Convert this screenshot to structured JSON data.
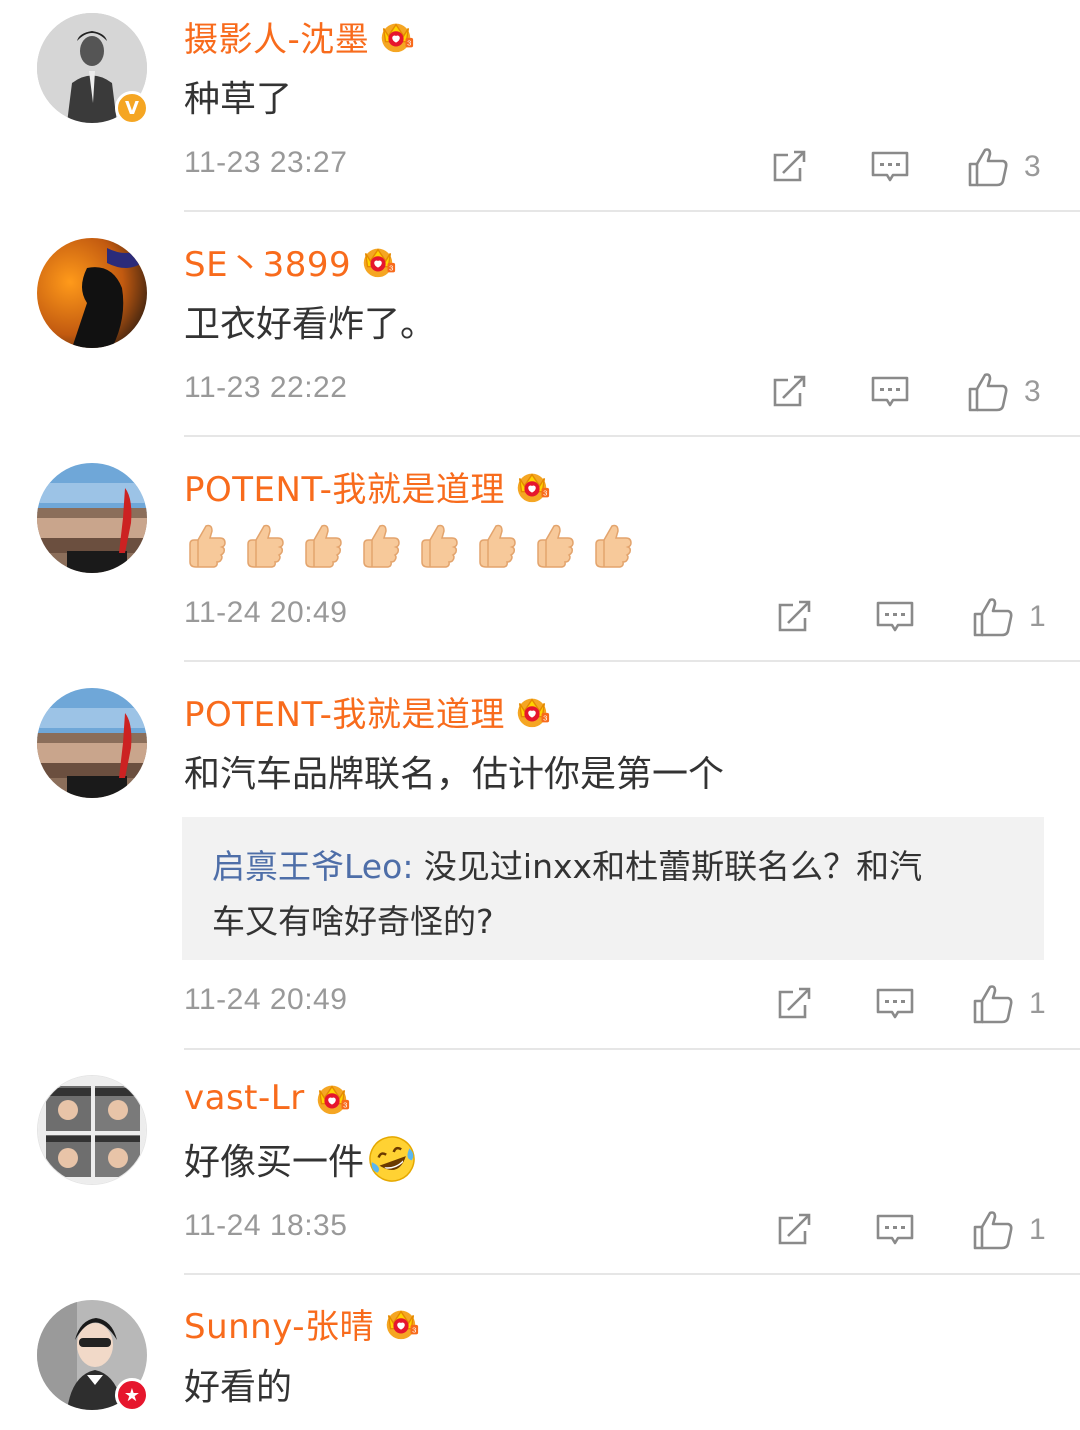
{
  "comments": [
    {
      "username": "摄影人-沈墨",
      "content": "种草了",
      "timestamp": "11-23 23:27",
      "likes": "3",
      "badge": "verified-yellow-v",
      "badge_color": "#F5A623"
    },
    {
      "username": "SE丶3899",
      "content": "卫衣好看炸了。",
      "timestamp": "11-23 22:22",
      "likes": "3"
    },
    {
      "username": "POTENT-我就是道理",
      "content_emoji": "thumbs-up",
      "content_emoji_count": 8,
      "timestamp": "11-24 20:49",
      "likes": "1"
    },
    {
      "username": "POTENT-我就是道理",
      "content": "和汽车品牌联名，估计你是第一个",
      "reply": {
        "username": "启禀王爷Leo",
        "separator": ": ",
        "line1": "没见过inxx和杜蕾斯联名么？和汽",
        "line2": "车又有啥好奇怪的?"
      },
      "timestamp": "11-24 20:49",
      "likes": "1"
    },
    {
      "username": "vast-Lr",
      "content": "好像买一件",
      "content_trailing_emoji": "laughing-crying-emoji",
      "timestamp": "11-24 18:35",
      "likes": "1"
    },
    {
      "username": "Sunny-张晴",
      "content": "好看的",
      "badge": "red-star-badge",
      "badge_color": "#E6162D"
    }
  ],
  "icons": {
    "member": "crown-icon",
    "forward": "share-icon",
    "comment": "comment-icon",
    "like": "thumbs-up-icon"
  },
  "colors": {
    "username": "#F86B1C",
    "reply_user": "#4E6EA8",
    "meta": "#999999",
    "reply_bg": "#F2F2F2"
  }
}
